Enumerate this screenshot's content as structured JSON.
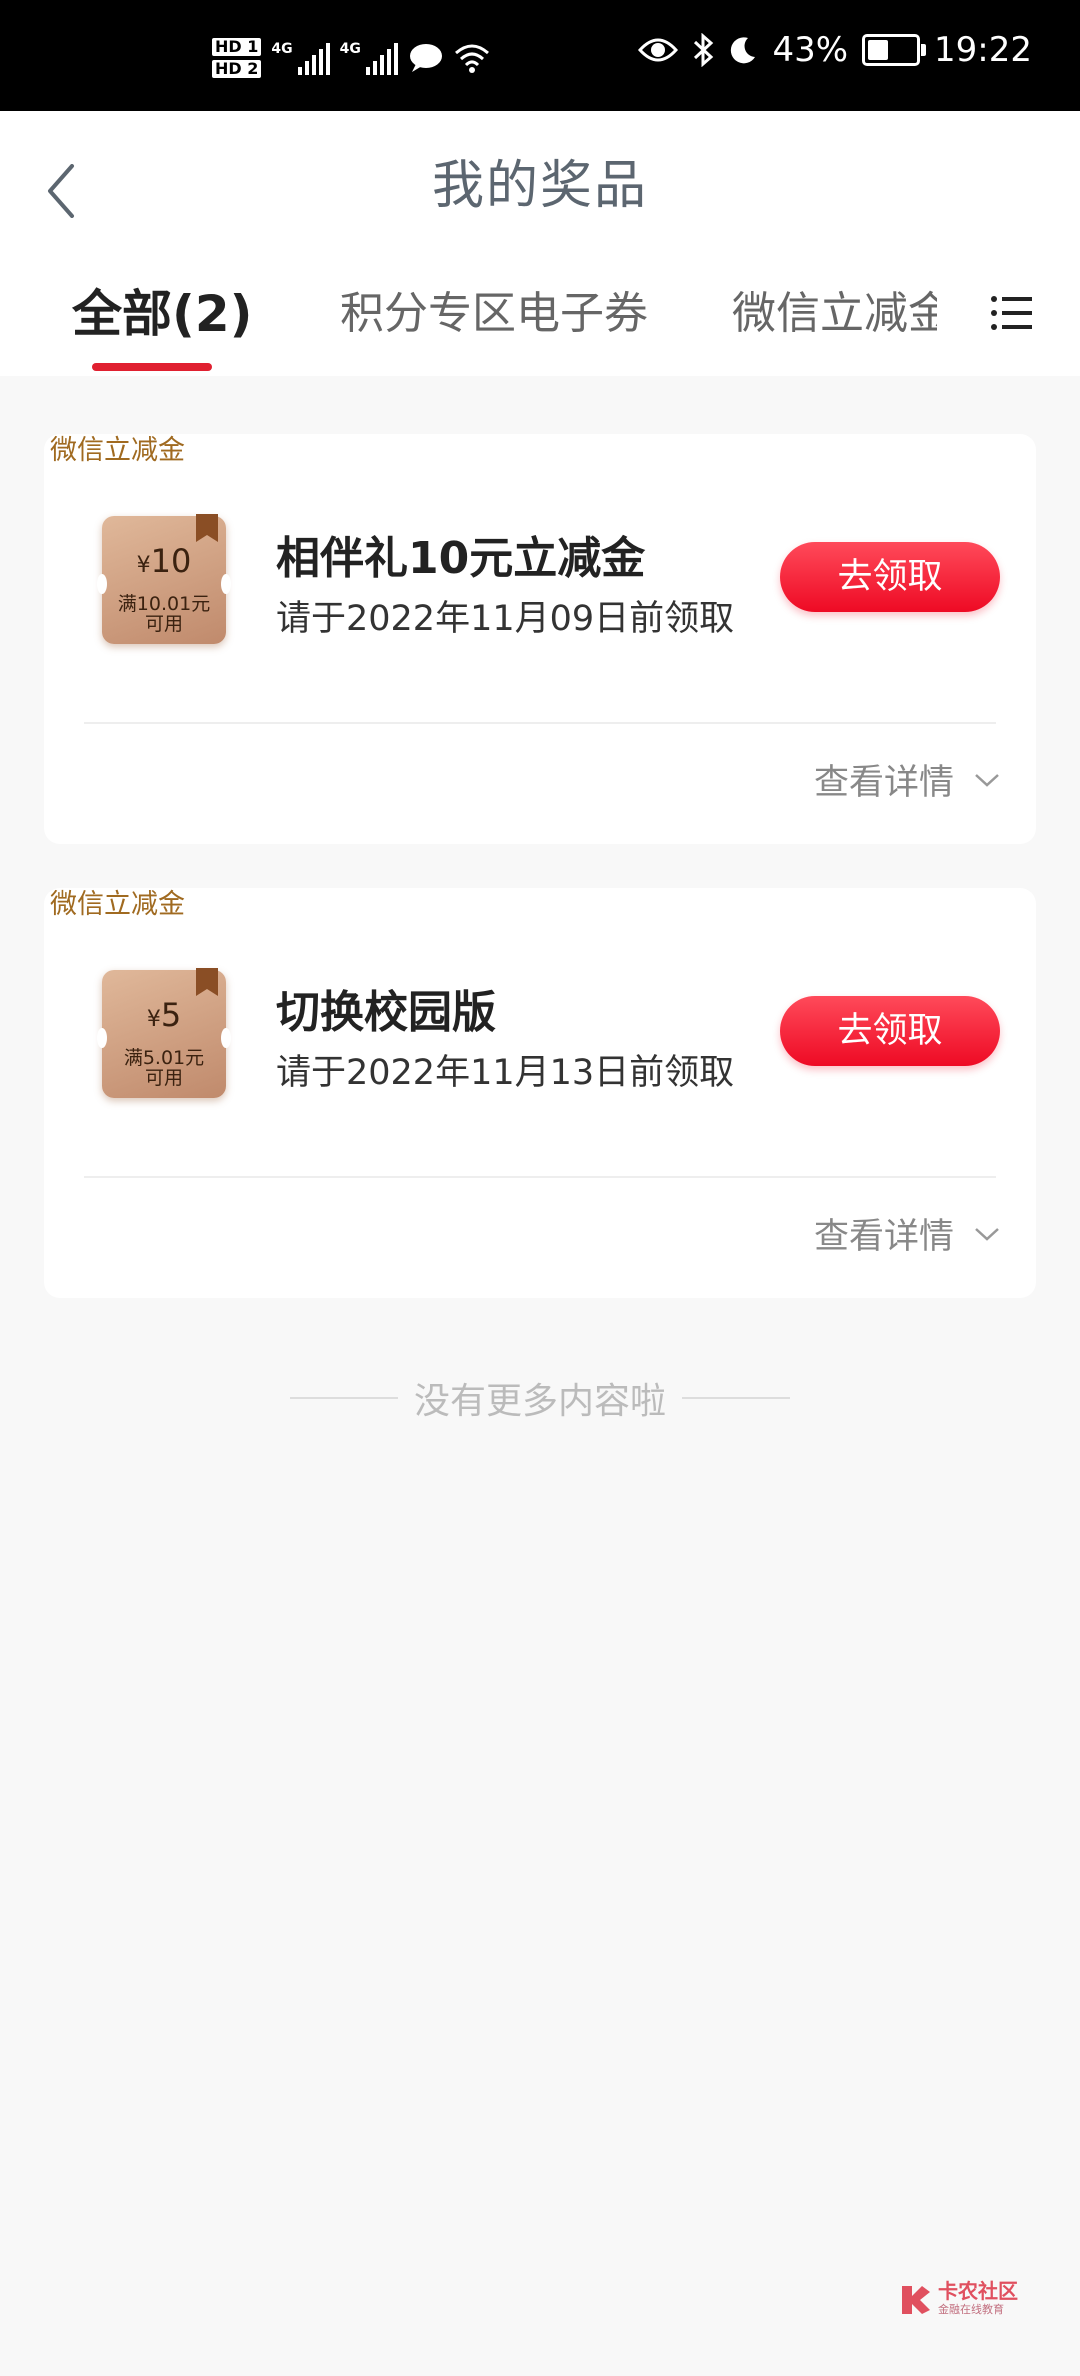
{
  "status_bar": {
    "sim1": "HD 1",
    "sim2": "HD 2",
    "net1": "4G",
    "net2": "4G",
    "battery": "43%",
    "time": "19:22"
  },
  "header": {
    "title": "我的奖品",
    "tabs": [
      {
        "label": "全部(2)",
        "active": true
      },
      {
        "label": "积分专区电子券",
        "active": false
      },
      {
        "label": "微信立减金(",
        "active": false
      }
    ]
  },
  "prizes": [
    {
      "tag": "微信立减金",
      "coupon_amount": "10",
      "coupon_symbol": "¥",
      "coupon_condition_1": "满10.01元",
      "coupon_condition_2": "可用",
      "name": "相伴礼10元立减金",
      "deadline": "请于2022年11月09日前领取",
      "button": "去领取",
      "detail": "查看详情"
    },
    {
      "tag": "微信立减金",
      "coupon_amount": "5",
      "coupon_symbol": "¥",
      "coupon_condition_1": "满5.01元",
      "coupon_condition_2": "可用",
      "name": "切换校园版",
      "deadline": "请于2022年11月13日前领取",
      "button": "去领取",
      "detail": "查看详情"
    }
  ],
  "footer": {
    "no_more": "没有更多内容啦"
  },
  "watermark": {
    "name": "卡农社区",
    "subtitle": "金融在线教育"
  },
  "colors": {
    "accent": "#ee0a24",
    "tag_text": "#a06a20"
  }
}
